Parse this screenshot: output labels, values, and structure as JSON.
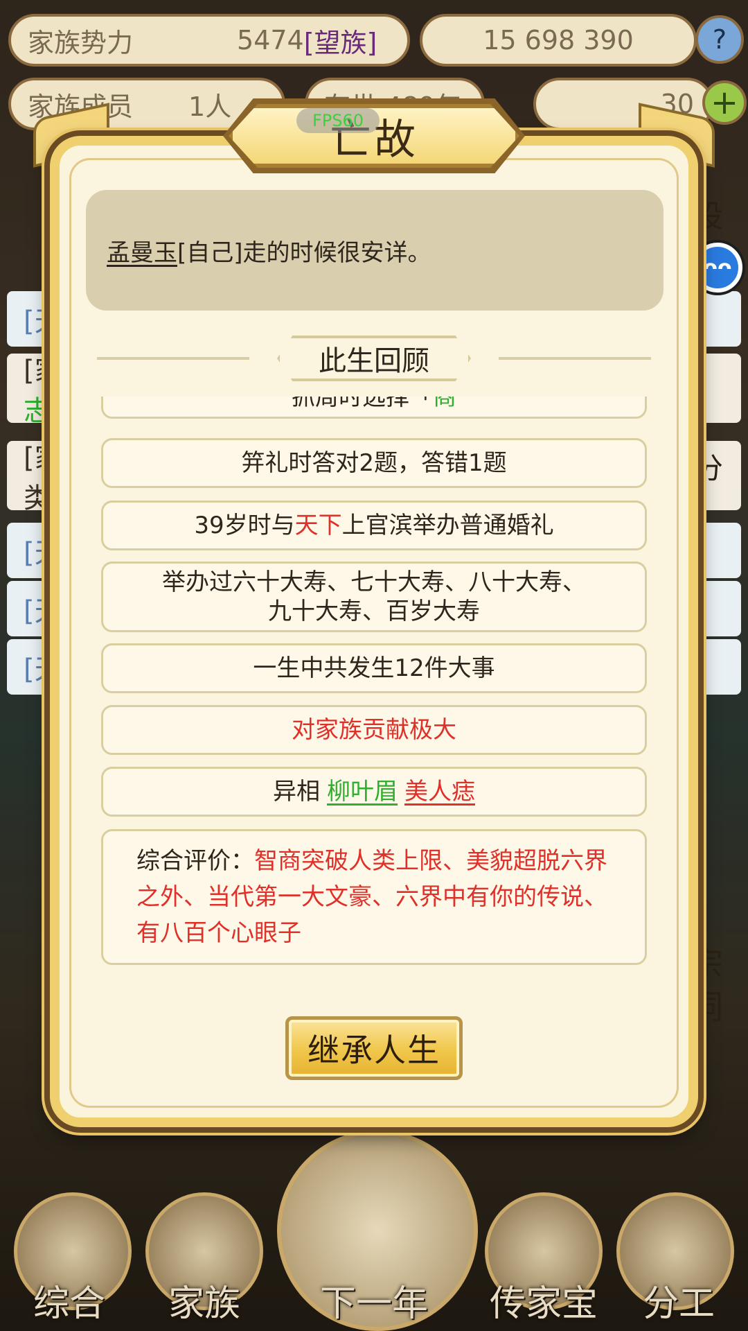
{
  "background": {
    "top_left_label": "家族势力",
    "top_left_value": "5474",
    "top_left_rank": "[望族]",
    "resources": "15  698  390",
    "help": "?",
    "members_label": "家族成员",
    "members_value": "1人",
    "years_label": "存世 489年",
    "gold_value": "30",
    "plus": "+",
    "settings_label": "设置",
    "row_char_1": "[天",
    "row_char_2": "[家",
    "row_char_3": "志",
    "row_char_4": "[家",
    "row_char_5": "类",
    "row_char_6": "[天",
    "row_char_7": "[天",
    "row_char_8": "[天",
    "right_char_1": "分",
    "right_char_2": "宗",
    "right_char_3": "祠",
    "nav": [
      "综合",
      "家族",
      "下一年",
      "传家宝",
      "分工"
    ]
  },
  "float_button": "ᴖᴖ",
  "dialog": {
    "title": "亡故",
    "fps": "FPS60",
    "message": {
      "name": "孟曼玉",
      "rest": "[自己]走的时候很安详。"
    },
    "section_title": "此生回顾",
    "items": {
      "partial_text": "抓周时选择「",
      "partial_highlight": "商",
      "item1": "笄礼时答对2题，答错1题",
      "item2_pre": "39岁时与",
      "item2_hl": "天下",
      "item2_post": "上官滨举办普通婚礼",
      "item3_line1": "举办过六十大寿、七十大寿、八十大寿、",
      "item3_line2": "九十大寿、百岁大寿",
      "item4": "一生中共发生12件大事",
      "item5": "对家族贡献极大",
      "item6_pre": "异相",
      "item6_green": "柳叶眉",
      "item6_red": "美人痣",
      "eval_label": "综合评价：",
      "eval_text": "智商突破人类上限、美貌超脱六界之外、当代第一大文豪、六界中有你的传说、有八百个心眼子"
    },
    "button_label": "继承人生"
  },
  "colors": {
    "accent_gold": "#f0cf6e",
    "highlight_red": "#e0302a",
    "highlight_green": "#2fae2f",
    "panel_bg": "#fbf5df"
  }
}
